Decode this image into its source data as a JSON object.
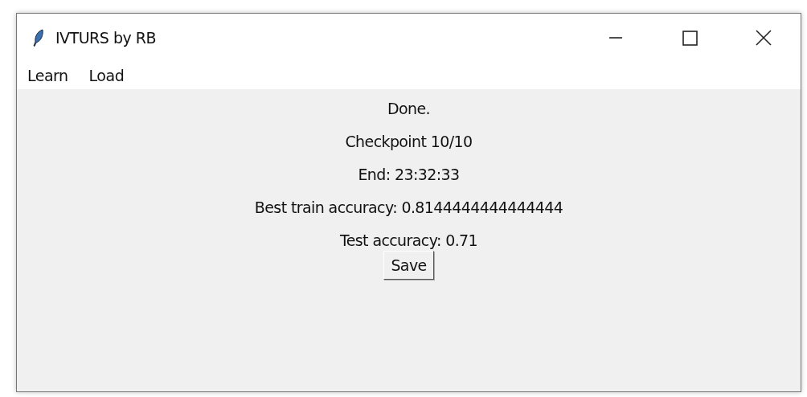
{
  "window": {
    "title": "IVTURS by RB"
  },
  "menu": [
    "Learn",
    "Load"
  ],
  "labels": [
    "Done.",
    "Checkpoint 10/10",
    "End: 23:32:33",
    "Best train accuracy: 0.8144444444444444",
    "Test accuracy: 0.71"
  ],
  "buttons": [
    "Save"
  ]
}
